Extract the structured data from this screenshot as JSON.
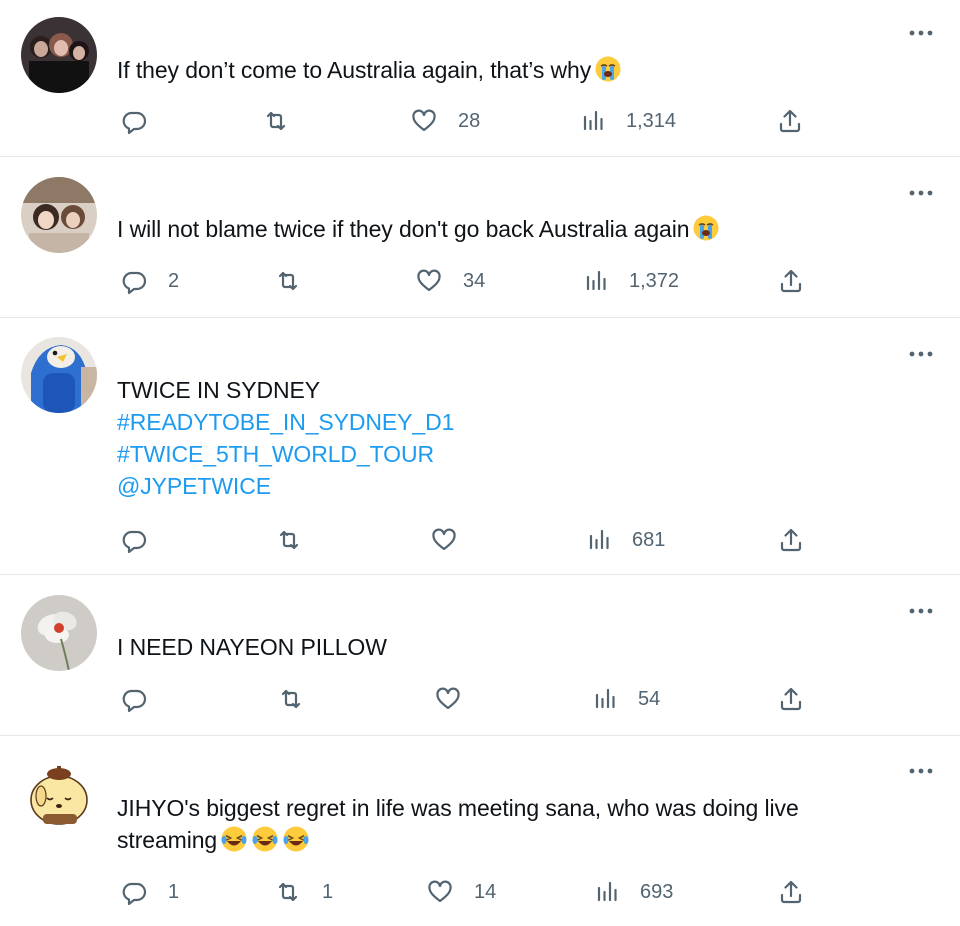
{
  "tweets": [
    {
      "avatar": "group-photo-avatar",
      "lines": [
        "If they don’t come to Australia again, that’s why"
      ],
      "emoji": [
        "crying-face-emoji"
      ],
      "replies": "",
      "retweets": "",
      "likes": "28",
      "views": "1,314"
    },
    {
      "avatar": "two-people-avatar",
      "lines": [
        "I will not blame twice if they don't go back Australia again"
      ],
      "emoji": [
        "crying-face-emoji"
      ],
      "replies": "2",
      "retweets": "",
      "likes": "34",
      "views": "1,372"
    },
    {
      "avatar": "penguin-costume-avatar",
      "lines": [
        "TWICE IN SYDNEY"
      ],
      "links": [
        "#READYTOBE_IN_SYDNEY_D1",
        "#TWICE_5TH_WORLD_TOUR",
        "@JYPETWICE"
      ],
      "replies": "",
      "retweets": "",
      "likes": "",
      "views": "681"
    },
    {
      "avatar": "flower-avatar",
      "lines": [
        "I NEED NAYEON PILLOW"
      ],
      "replies": "",
      "retweets": "",
      "likes": "",
      "views": "54"
    },
    {
      "avatar": "pompompurin-avatar",
      "lines": [
        "JIHYO's biggest regret in life was meeting sana, who was doing live",
        "streaming"
      ],
      "emoji": [
        "laughing-tears-emoji",
        "laughing-tears-emoji",
        "laughing-tears-emoji"
      ],
      "replies": "1",
      "retweets": "1",
      "likes": "14",
      "views": "693"
    }
  ],
  "colors": {
    "text": "#0f1419",
    "muted": "#536471",
    "link": "#1d9bf0",
    "divider": "#e6e9ec"
  }
}
